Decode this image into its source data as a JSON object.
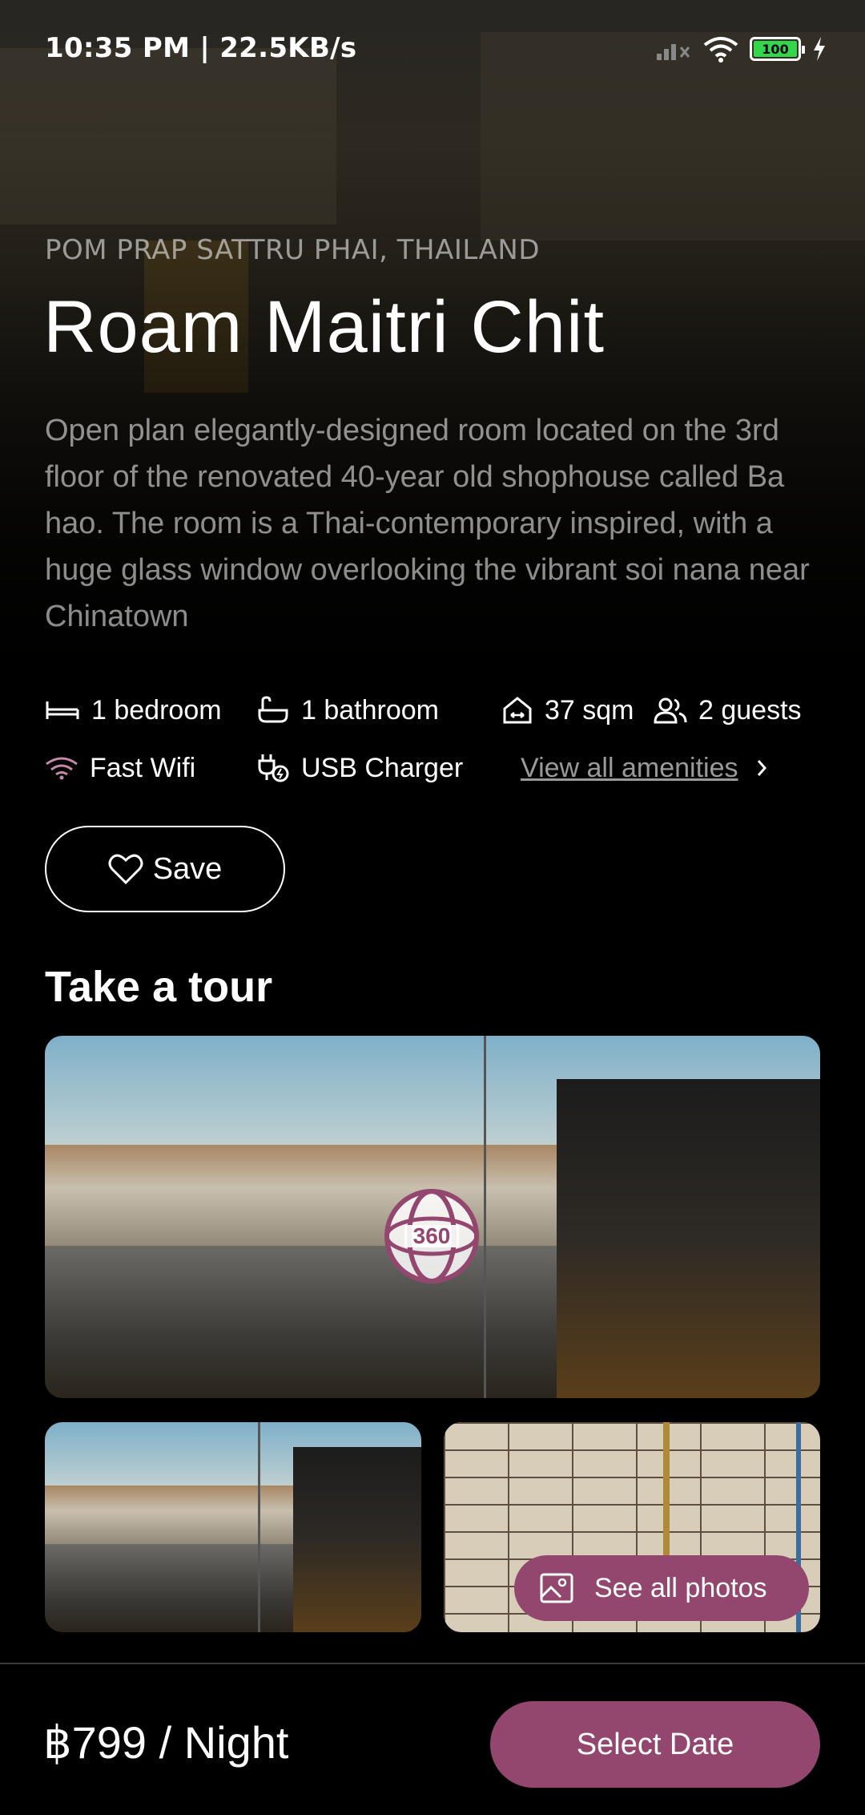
{
  "status_bar": {
    "time": "10:35 PM | 22.5KB/s",
    "battery": "100",
    "icons": [
      "notification-icon",
      "notification-icon",
      "signal-icon",
      "wifi-icon",
      "battery-icon",
      "charging-icon"
    ]
  },
  "listing": {
    "location": "POM PRAP SATTRU PHAI, THAILAND",
    "title": "Roam Maitri Chit",
    "description": "Open plan elegantly-designed room located on the 3rd floor of the renovated 40-year old shophouse called Ba hao. The room is a Thai-contemporary inspired, with a huge glass window overlooking the vibrant soi nana near Chinatown"
  },
  "features": {
    "bedrooms": "1 bedroom",
    "bathrooms": "1 bathroom",
    "area": "37 sqm",
    "guests": "2 guests",
    "wifi": "Fast Wifi",
    "charger": "USB Charger",
    "view_all": "View all amenities"
  },
  "actions": {
    "save": "Save"
  },
  "tour": {
    "title": "Take a tour",
    "badge": "360",
    "see_all": "See all photos"
  },
  "booking": {
    "price": "฿799 / Night",
    "select_date": "Select Date"
  },
  "colors": {
    "accent": "#93476e",
    "background": "#000000"
  }
}
